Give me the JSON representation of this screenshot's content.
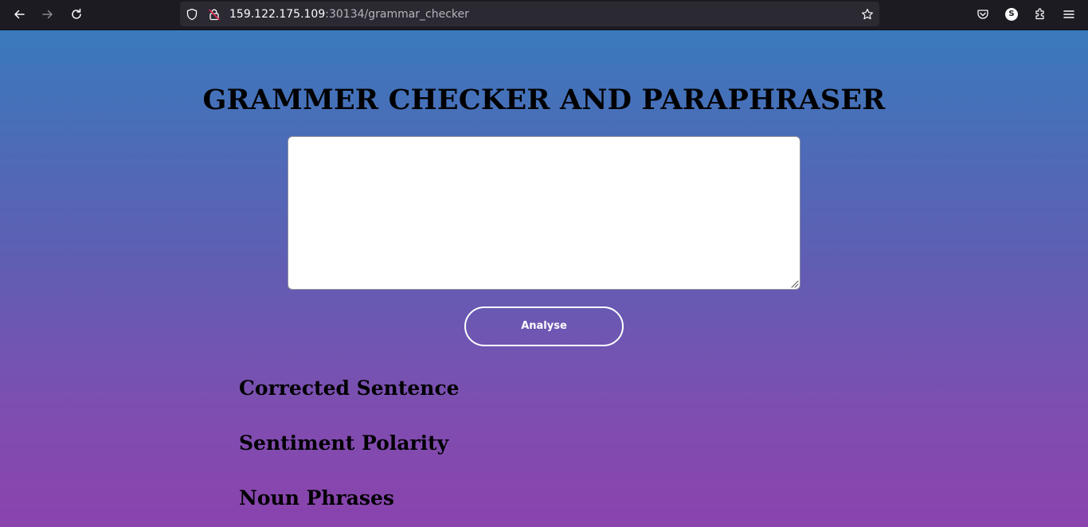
{
  "browser": {
    "url_host": "159.122.175.109",
    "url_rest": ":30134/grammar_checker",
    "profile_initial": "S"
  },
  "icons": {
    "back": "back-arrow-icon",
    "forward": "forward-arrow-icon",
    "reload": "reload-icon",
    "tracking": "shield-icon",
    "insecure": "insecure-lock-icon",
    "bookmark": "star-icon",
    "pocket": "pocket-icon",
    "extensions": "puzzle-icon",
    "menu": "hamburger-menu-icon"
  },
  "page": {
    "title": "GRAMMER CHECKER AND PARAPHRASER",
    "input_text": "",
    "analyse_label": "Analyse",
    "sections": [
      "Corrected Sentence",
      "Sentiment Polarity",
      "Noun Phrases"
    ]
  },
  "colors": {
    "gradient_top": "#3a79bc",
    "gradient_bottom": "#8a43ad",
    "chrome_bg": "#1c1b22",
    "urlbar_bg": "#2b2a33"
  }
}
